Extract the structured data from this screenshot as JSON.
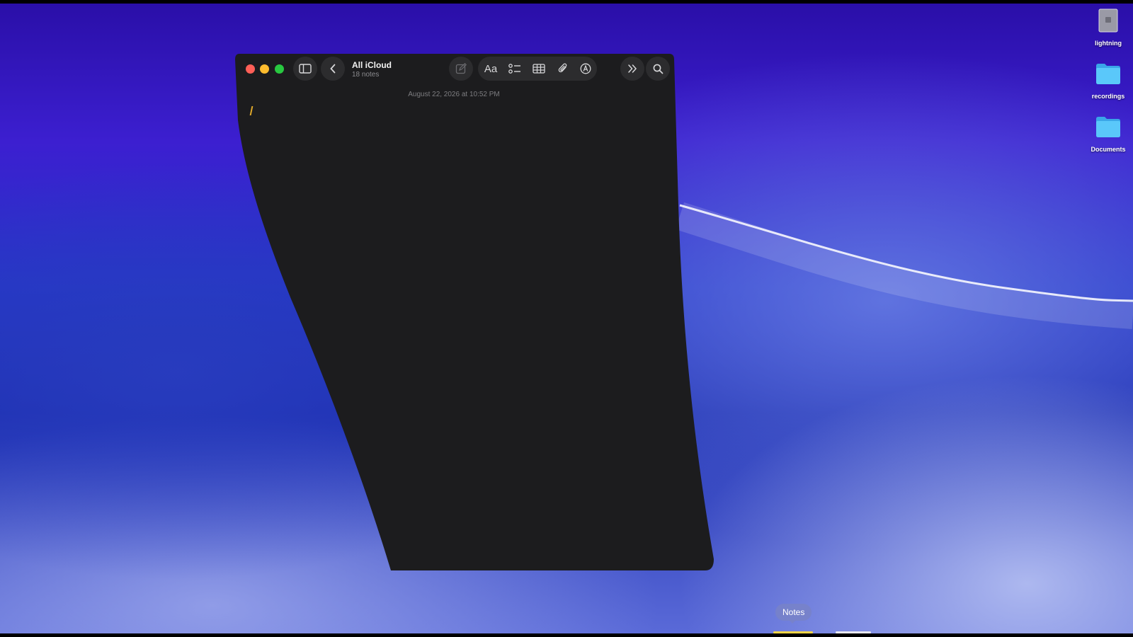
{
  "window": {
    "title": "All iCloud",
    "subtitle": "18 notes",
    "note_date": "August 22, 2026 at 10:52 PM",
    "toolbar": {
      "sidebar_icon": "sidebar-icon",
      "back_icon": "chevron-left-icon",
      "compose_icon": "compose-icon",
      "format_label": "Aa",
      "checklist_icon": "checklist-icon",
      "table_icon": "table-icon",
      "attach_icon": "paperclip-icon",
      "markup_icon": "markup-icon",
      "more_icon": "double-chevron-icon",
      "search_icon": "search-icon"
    },
    "traffic_lights": {
      "close": "#ff5f57",
      "minimize": "#febc2e",
      "zoom": "#28c840"
    }
  },
  "desktop": {
    "items": [
      {
        "label": "lightning",
        "icon": "document-icon"
      },
      {
        "label": "recordings",
        "icon": "folder-icon"
      },
      {
        "label": "Documents",
        "icon": "folder-icon"
      }
    ]
  },
  "dock": {
    "tooltip": "Notes"
  },
  "colors": {
    "window_bg": "#1c1c1e",
    "folder_blue": "#5ac8fa",
    "cursor": "#e0a92a"
  }
}
